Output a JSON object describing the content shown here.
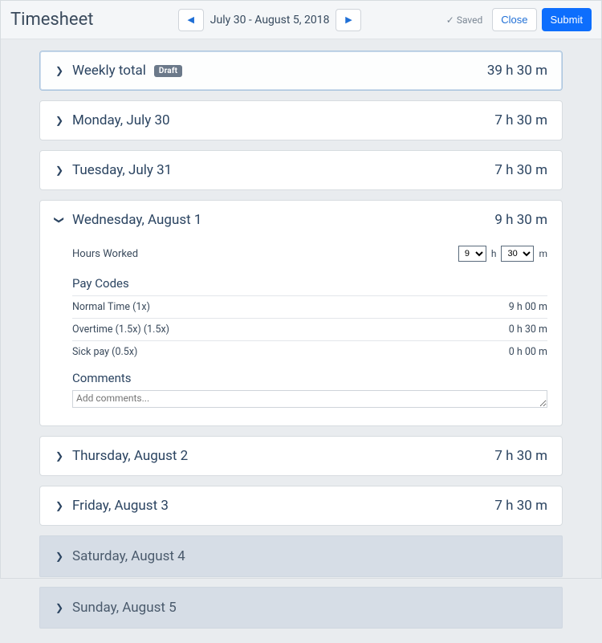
{
  "header": {
    "title": "Timesheet",
    "prev_icon": "◀",
    "next_icon": "▶",
    "date_range": "July 30 - August 5, 2018",
    "saved_label": "✓ Saved",
    "close_label": "Close",
    "submit_label": "Submit"
  },
  "weekly": {
    "label": "Weekly total",
    "badge": "Draft",
    "total": "39 h 30 m"
  },
  "days": [
    {
      "label": "Monday, July 30",
      "total": "7 h 30 m"
    },
    {
      "label": "Tuesday, July 31",
      "total": "7 h 30 m"
    },
    {
      "label": "Wednesday, August 1",
      "total": "9 h 30 m"
    },
    {
      "label": "Thursday, August 2",
      "total": "7 h 30 m"
    },
    {
      "label": "Friday, August 3",
      "total": "7 h 30 m"
    },
    {
      "label": "Saturday, August 4",
      "total": ""
    },
    {
      "label": "Sunday, August 5",
      "total": ""
    }
  ],
  "expanded": {
    "hours_worked_label": "Hours Worked",
    "hours_value": "9",
    "minutes_value": "30",
    "h_unit": "h",
    "m_unit": "m",
    "paycodes_label": "Pay Codes",
    "paycodes": [
      {
        "name": "Normal Time (1x)",
        "value": "9 h 00 m"
      },
      {
        "name": "Overtime (1.5x) (1.5x)",
        "value": "0 h 30 m"
      },
      {
        "name": "Sick pay (0.5x)",
        "value": "0 h 00 m"
      }
    ],
    "comments_label": "Comments",
    "comments_placeholder": "Add comments..."
  },
  "chev_right": "❯",
  "chev_down": "❯"
}
